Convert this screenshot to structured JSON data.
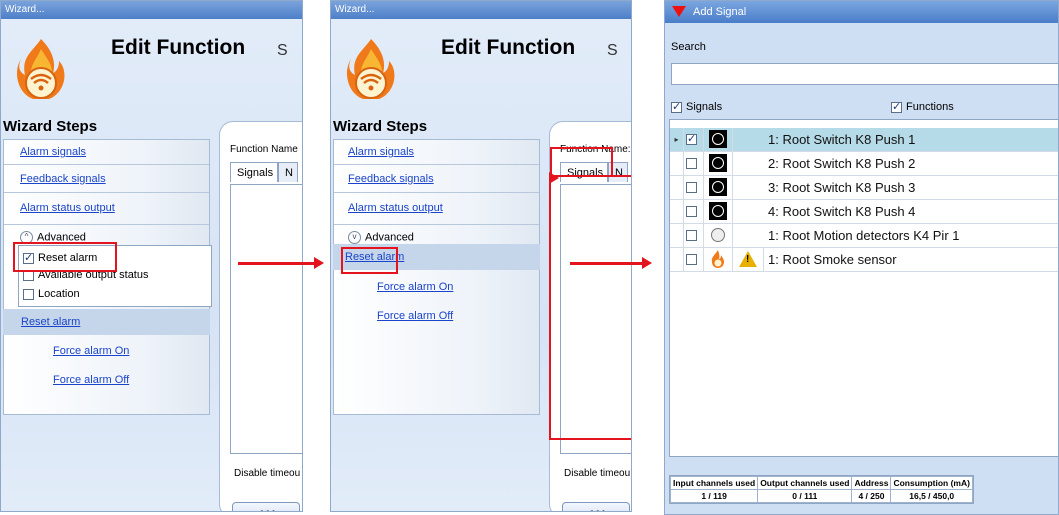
{
  "wizard1": {
    "window_title": "Wizard...",
    "title": "Edit Function",
    "subtitle": "S",
    "steps_title": "Wizard Steps",
    "steps": [
      "Alarm signals",
      "Feedback signals",
      "Alarm status output"
    ],
    "advanced_label": "Advanced",
    "advanced_options": [
      {
        "label": "Reset alarm",
        "checked": true
      },
      {
        "label": "Available output status",
        "checked": false
      },
      {
        "label": "Location",
        "checked": false
      }
    ],
    "reset_alarm": "Reset alarm",
    "force_on": "Force alarm On",
    "force_off": "Force alarm Off",
    "function_name_label": "Function Name",
    "tab_signals": "Signals",
    "tab_next": "N",
    "disable_label": "Disable timeou",
    "back_button": "<<<"
  },
  "wizard2": {
    "window_title": "Wizard...",
    "title": "Edit Function",
    "subtitle": "S",
    "steps_title": "Wizard Steps",
    "steps": [
      "Alarm signals",
      "Feedback signals",
      "Alarm status output"
    ],
    "advanced_label": "Advanced",
    "reset_alarm": "Reset alarm",
    "force_on": "Force alarm On",
    "force_off": "Force alarm Off",
    "function_name_label": "Function Name:",
    "tab_signals": "Signals",
    "tab_next": "N",
    "disable_label": "Disable timeou",
    "back_button": "<<<"
  },
  "add_signal": {
    "window_title": "Add Signal",
    "search_label": "Search",
    "search_value": "",
    "filter_signals": "Signals",
    "filter_functions": "Functions",
    "rows": [
      {
        "label": "1: Root Switch K8 Push 1",
        "checked": true,
        "icon": "switch-icon"
      },
      {
        "label": "2: Root Switch K8 Push 2",
        "checked": false,
        "icon": "switch-icon"
      },
      {
        "label": "3: Root Switch K8 Push 3",
        "checked": false,
        "icon": "switch-icon"
      },
      {
        "label": "4: Root Switch K8 Push 4",
        "checked": false,
        "icon": "switch-icon"
      },
      {
        "label": "1: Root Motion detectors K4 Pir 1",
        "checked": false,
        "icon": "motion-detector-icon"
      },
      {
        "label": "1: Root Smoke sensor",
        "checked": false,
        "icon": "smoke-sensor-icon"
      }
    ],
    "status_headers": [
      "Input channels used",
      "Output channels used",
      "Address",
      "Consumption (mA)"
    ],
    "status_values": [
      "1 / 119",
      "0 / 111",
      "4 / 250",
      "16,5 / 450,0"
    ]
  },
  "colors": {
    "highlight": "#e3141e",
    "link": "#1a44c9",
    "selected_row": "#b6dbe8"
  }
}
